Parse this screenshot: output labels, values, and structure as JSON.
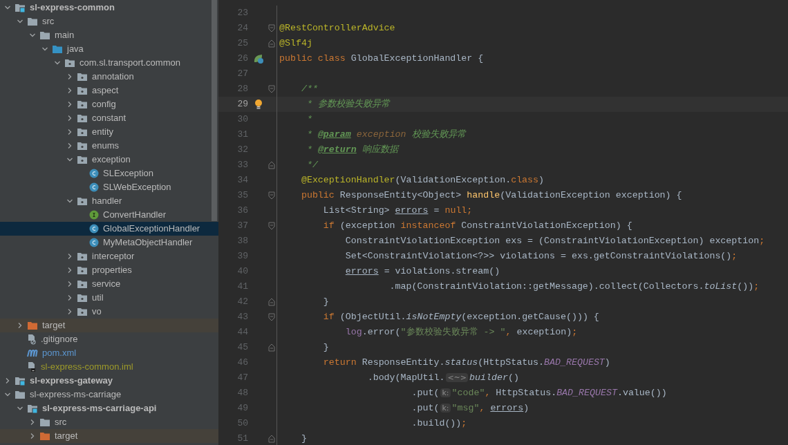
{
  "project_tree": [
    {
      "kind": "module",
      "name": "sl-express-common",
      "expanded": true,
      "selected": false,
      "children": [
        {
          "kind": "folder",
          "name": "src",
          "expanded": true,
          "selected": false,
          "children": [
            {
              "kind": "folder",
              "name": "main",
              "expanded": true,
              "selected": false,
              "children": [
                {
                  "kind": "source",
                  "name": "java",
                  "expanded": true,
                  "selected": false,
                  "children": [
                    {
                      "kind": "package",
                      "name": "com.sl.transport.common",
                      "expanded": true,
                      "selected": false,
                      "children": [
                        {
                          "kind": "package",
                          "name": "annotation",
                          "expanded": false,
                          "selected": false
                        },
                        {
                          "kind": "package",
                          "name": "aspect",
                          "expanded": false,
                          "selected": false
                        },
                        {
                          "kind": "package",
                          "name": "config",
                          "expanded": false,
                          "selected": false
                        },
                        {
                          "kind": "package",
                          "name": "constant",
                          "expanded": false,
                          "selected": false
                        },
                        {
                          "kind": "package",
                          "name": "entity",
                          "expanded": false,
                          "selected": false
                        },
                        {
                          "kind": "package",
                          "name": "enums",
                          "expanded": false,
                          "selected": false
                        },
                        {
                          "kind": "package",
                          "name": "exception",
                          "expanded": true,
                          "selected": false,
                          "children": [
                            {
                              "kind": "class",
                              "name": "SLException",
                              "selected": false
                            },
                            {
                              "kind": "class",
                              "name": "SLWebException",
                              "selected": false
                            }
                          ]
                        },
                        {
                          "kind": "package",
                          "name": "handler",
                          "expanded": true,
                          "selected": false,
                          "children": [
                            {
                              "kind": "interface",
                              "name": "ConvertHandler",
                              "selected": false
                            },
                            {
                              "kind": "class",
                              "name": "GlobalExceptionHandler",
                              "selected": true
                            },
                            {
                              "kind": "class",
                              "name": "MyMetaObjectHandler",
                              "selected": false
                            }
                          ]
                        },
                        {
                          "kind": "package",
                          "name": "interceptor",
                          "expanded": false,
                          "selected": false
                        },
                        {
                          "kind": "package",
                          "name": "properties",
                          "expanded": false,
                          "selected": false
                        },
                        {
                          "kind": "package",
                          "name": "service",
                          "expanded": false,
                          "selected": false
                        },
                        {
                          "kind": "package",
                          "name": "util",
                          "expanded": false,
                          "selected": false
                        },
                        {
                          "kind": "package",
                          "name": "vo",
                          "expanded": false,
                          "selected": false
                        }
                      ]
                    }
                  ]
                }
              ]
            }
          ]
        },
        {
          "kind": "excluded",
          "name": "target",
          "expanded": false,
          "selected": false
        },
        {
          "kind": "ignore",
          "name": ".gitignore",
          "selected": false
        },
        {
          "kind": "maven",
          "name": "pom.xml",
          "selected": false
        },
        {
          "kind": "iml",
          "name": "sl-express-common.iml",
          "selected": false
        }
      ]
    },
    {
      "kind": "module",
      "name": "sl-express-gateway",
      "expanded": false,
      "selected": false
    },
    {
      "kind": "folder",
      "name": "sl-express-ms-carriage",
      "expanded": true,
      "selected": false,
      "children": [
        {
          "kind": "module",
          "name": "sl-express-ms-carriage-api",
          "expanded": true,
          "selected": false,
          "children": [
            {
              "kind": "folder",
              "name": "src",
              "expanded": false,
              "selected": false
            },
            {
              "kind": "excluded",
              "name": "target",
              "expanded": false,
              "selected": false
            }
          ]
        }
      ]
    }
  ],
  "editor": {
    "lines": [
      {
        "number": "23"
      },
      {
        "number": "24",
        "fold_marker": {
          "kind": "start"
        },
        "tokens": [
          {
            "kind": "annotation",
            "text": "@RestControllerAdvice"
          }
        ]
      },
      {
        "number": "25",
        "fold_marker": {
          "kind": "end"
        },
        "tokens": [
          {
            "kind": "annotation",
            "text": "@Slf4j"
          }
        ]
      },
      {
        "number": "26",
        "gutter_icon": {
          "kind": "bean"
        },
        "tokens": [
          {
            "kind": "keyword",
            "text": "public class "
          },
          {
            "kind": "plain",
            "text": "GlobalExceptionHandler {"
          }
        ]
      },
      {
        "number": "27"
      },
      {
        "number": "28",
        "fold_marker": {
          "kind": "start"
        },
        "tokens": [
          {
            "kind": "comment",
            "text": "    /**"
          }
        ]
      },
      {
        "number": "29",
        "current": true,
        "gutter_icon": {
          "kind": "bulb"
        },
        "tokens": [
          {
            "kind": "comment",
            "text": "     * 参数校验失败异常"
          }
        ]
      },
      {
        "number": "30",
        "tokens": [
          {
            "kind": "comment",
            "text": "     *"
          }
        ]
      },
      {
        "number": "31",
        "tokens": [
          {
            "kind": "comment",
            "text": "     * "
          },
          {
            "kind": "doctag",
            "text": "@param"
          },
          {
            "kind": "param",
            "text": " exception"
          },
          {
            "kind": "comment",
            "text": " 校验失败异常"
          }
        ]
      },
      {
        "number": "32",
        "tokens": [
          {
            "kind": "comment",
            "text": "     * "
          },
          {
            "kind": "doctag",
            "text": "@return"
          },
          {
            "kind": "comment",
            "text": " 响应数据"
          }
        ]
      },
      {
        "number": "33",
        "fold_marker": {
          "kind": "end"
        },
        "tokens": [
          {
            "kind": "comment",
            "text": "     */"
          }
        ]
      },
      {
        "number": "34",
        "tokens": [
          {
            "kind": "annotation",
            "text": "    @ExceptionHandler"
          },
          {
            "kind": "plain",
            "text": "(ValidationException."
          },
          {
            "kind": "keyword",
            "text": "class"
          },
          {
            "kind": "plain",
            "text": ")"
          }
        ]
      },
      {
        "number": "35",
        "fold_marker": {
          "kind": "start"
        },
        "tokens": [
          {
            "kind": "keyword",
            "text": "    public "
          },
          {
            "kind": "plain",
            "text": "ResponseEntity<Object> "
          },
          {
            "kind": "method",
            "text": "handle"
          },
          {
            "kind": "plain",
            "text": "(ValidationException exception) {"
          }
        ]
      },
      {
        "number": "36",
        "tokens": [
          {
            "kind": "plain",
            "text": "        List<String> "
          },
          {
            "kind": "local",
            "text": "errors"
          },
          {
            "kind": "plain",
            "text": " = "
          },
          {
            "kind": "keyword",
            "text": "null;"
          }
        ]
      },
      {
        "number": "37",
        "fold_marker": {
          "kind": "start"
        },
        "tokens": [
          {
            "kind": "keyword",
            "text": "        if "
          },
          {
            "kind": "plain",
            "text": "(exception "
          },
          {
            "kind": "keyword",
            "text": "instanceof "
          },
          {
            "kind": "plain",
            "text": "ConstraintViolationException) {"
          }
        ]
      },
      {
        "number": "38",
        "tokens": [
          {
            "kind": "plain",
            "text": "            ConstraintViolationException exs = (ConstraintViolationException) exception"
          },
          {
            "kind": "keyword",
            "text": ";"
          }
        ]
      },
      {
        "number": "39",
        "tokens": [
          {
            "kind": "plain",
            "text": "            Set<ConstraintViolation<?>> violations = exs.getConstraintViolations()"
          },
          {
            "kind": "keyword",
            "text": ";"
          }
        ]
      },
      {
        "number": "40",
        "tokens": [
          {
            "kind": "local",
            "text": "            errors"
          },
          {
            "kind": "plain",
            "text": " = violations.stream()"
          }
        ]
      },
      {
        "number": "41",
        "tokens": [
          {
            "kind": "plain",
            "text": "                    .map(ConstraintViolation::getMessage).collect(Collectors."
          },
          {
            "kind": "static",
            "text": "toList"
          },
          {
            "kind": "plain",
            "text": "())"
          },
          {
            "kind": "keyword",
            "text": ";"
          }
        ]
      },
      {
        "number": "42",
        "fold_marker": {
          "kind": "end"
        },
        "tokens": [
          {
            "kind": "plain",
            "text": "        }"
          }
        ]
      },
      {
        "number": "43",
        "fold_marker": {
          "kind": "start"
        },
        "tokens": [
          {
            "kind": "keyword",
            "text": "        if "
          },
          {
            "kind": "plain",
            "text": "(ObjectUtil."
          },
          {
            "kind": "static",
            "text": "isNotEmpty"
          },
          {
            "kind": "plain",
            "text": "(exception.getCause())) {"
          }
        ]
      },
      {
        "number": "44",
        "tokens": [
          {
            "kind": "field",
            "text": "            log"
          },
          {
            "kind": "plain",
            "text": ".error("
          },
          {
            "kind": "string",
            "text": "\"参数校验失败异常 -> \""
          },
          {
            "kind": "keyword",
            "text": ", "
          },
          {
            "kind": "plain",
            "text": "exception)"
          },
          {
            "kind": "keyword",
            "text": ";"
          }
        ]
      },
      {
        "number": "45",
        "fold_marker": {
          "kind": "end"
        },
        "tokens": [
          {
            "kind": "plain",
            "text": "        }"
          }
        ]
      },
      {
        "number": "46",
        "tokens": [
          {
            "kind": "keyword",
            "text": "        return "
          },
          {
            "kind": "plain",
            "text": "ResponseEntity."
          },
          {
            "kind": "static",
            "text": "status"
          },
          {
            "kind": "plain",
            "text": "(HttpStatus."
          },
          {
            "kind": "constant",
            "text": "BAD_REQUEST"
          },
          {
            "kind": "plain",
            "text": ")"
          }
        ]
      },
      {
        "number": "47",
        "tokens": [
          {
            "kind": "plain",
            "text": "                .body(MapUtil."
          },
          {
            "kind": "hint",
            "text": "<~>"
          },
          {
            "kind": "static",
            "text": "builder"
          },
          {
            "kind": "plain",
            "text": "()"
          }
        ]
      },
      {
        "number": "48",
        "tokens": [
          {
            "kind": "plain",
            "text": "                        .put("
          },
          {
            "kind": "hint",
            "text": "k:"
          },
          {
            "kind": "string",
            "text": "\"code\""
          },
          {
            "kind": "keyword",
            "text": ", "
          },
          {
            "kind": "plain",
            "text": "HttpStatus."
          },
          {
            "kind": "constant",
            "text": "BAD_REQUEST"
          },
          {
            "kind": "plain",
            "text": ".value())"
          }
        ]
      },
      {
        "number": "49",
        "tokens": [
          {
            "kind": "plain",
            "text": "                        .put("
          },
          {
            "kind": "hint",
            "text": "k:"
          },
          {
            "kind": "string",
            "text": "\"msg\""
          },
          {
            "kind": "keyword",
            "text": ", "
          },
          {
            "kind": "local",
            "text": "errors"
          },
          {
            "kind": "plain",
            "text": ")"
          }
        ]
      },
      {
        "number": "50",
        "tokens": [
          {
            "kind": "plain",
            "text": "                        .build())"
          },
          {
            "kind": "keyword",
            "text": ";"
          }
        ]
      },
      {
        "number": "51",
        "fold_marker": {
          "kind": "end"
        },
        "tokens": [
          {
            "kind": "plain",
            "text": "    }"
          }
        ]
      }
    ]
  }
}
